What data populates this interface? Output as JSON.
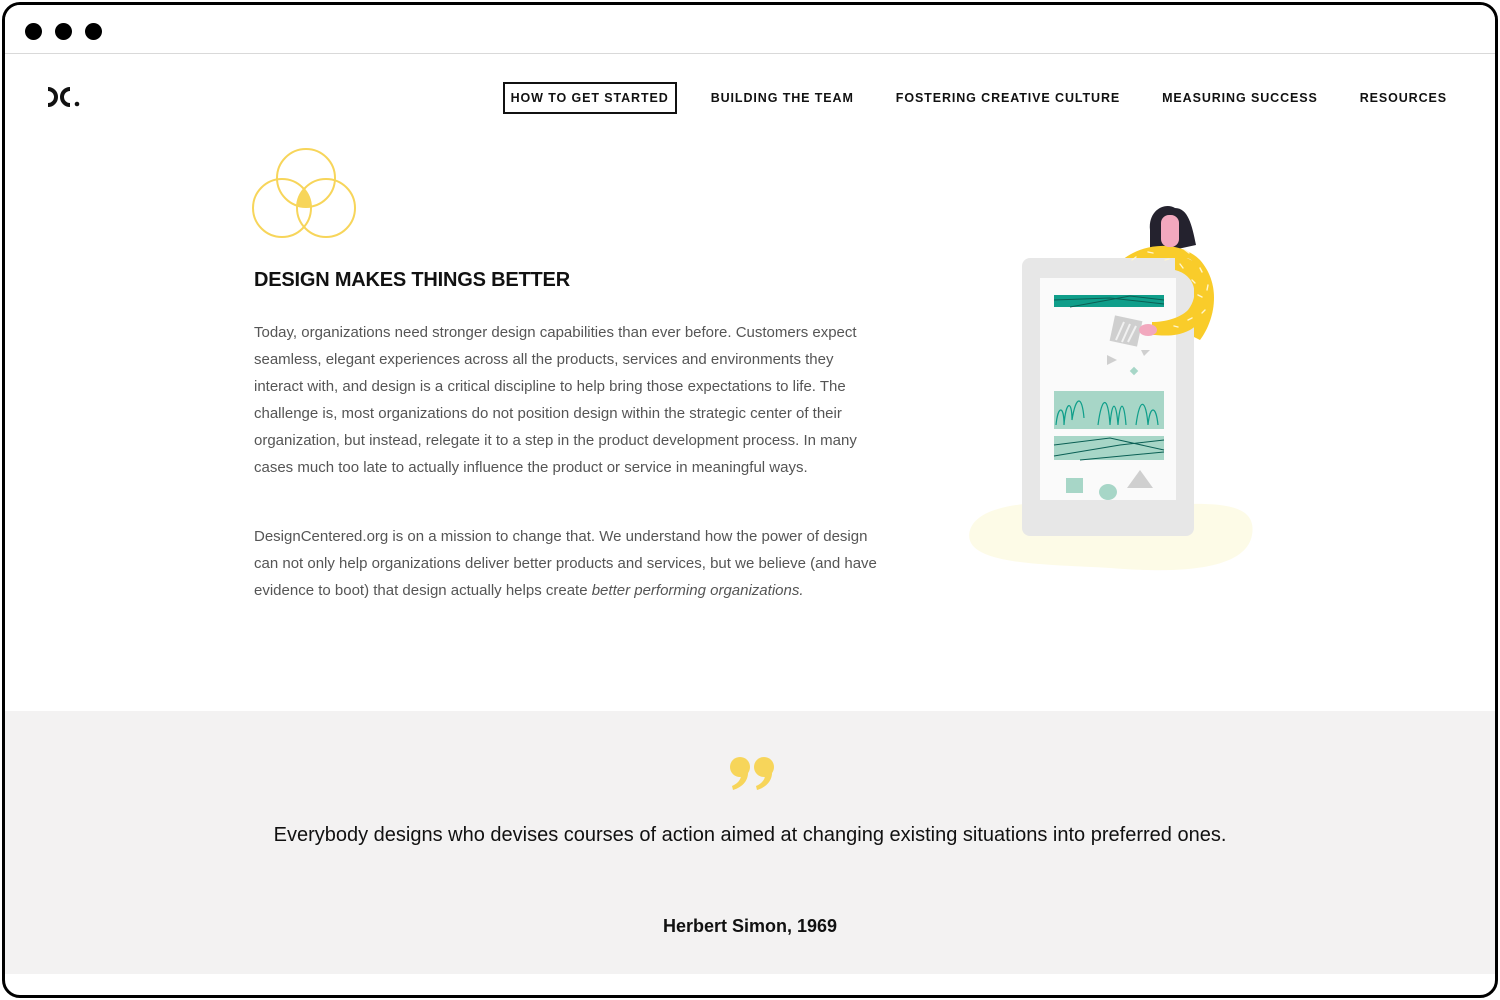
{
  "window": {
    "controls": [
      "close-dot",
      "minimize-dot",
      "maximize-dot"
    ]
  },
  "header": {
    "logo_text": "DC.",
    "nav": [
      {
        "label": "HOW TO GET STARTED",
        "active": true
      },
      {
        "label": "BUILDING THE TEAM",
        "active": false
      },
      {
        "label": "FOSTERING CREATIVE CULTURE",
        "active": false
      },
      {
        "label": "MEASURING SUCCESS",
        "active": false
      },
      {
        "label": "RESOURCES",
        "active": false
      }
    ]
  },
  "intro": {
    "icon": "venn-diagram-icon",
    "heading": "DESIGN MAKES THINGS BETTER",
    "paragraph1": "Today, organizations need stronger design capabilities than ever before. Customers expect seamless, elegant experiences across all the products, services and environments they interact with, and design is a critical discipline to help bring those expectations to life. The challenge is, most organizations do not position design within the strategic center of their organization, but instead, relegate it to a step in the product development process. In many cases much too late to actually influence the product or service in meaningful ways.",
    "paragraph2_start": "DesignCentered.org is on a mission to change that. We understand how the power of design can not only help organizations deliver better products and services, but we believe (and have evidence to boot) that design actually helps create ",
    "paragraph2_emphasis": "better performing organizations.",
    "illustration": "woman-with-tablet-illustration"
  },
  "quote": {
    "icon": "quote-mark-icon",
    "text": "Everybody designs who devises courses of action aimed at changing existing situations into preferred ones.",
    "author": "Herbert Simon, 1969"
  },
  "colors": {
    "accent_yellow": "#f7d55a",
    "teal": "#0f9e8a",
    "mint": "#a7d6c7",
    "quote_bg": "#f3f2f2",
    "body_text": "#555555"
  }
}
